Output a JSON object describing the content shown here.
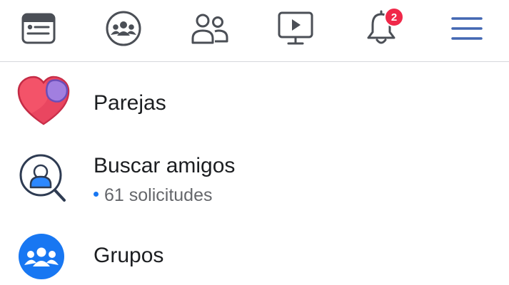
{
  "tabs": [
    {
      "name": "news-feed",
      "icon": "news-feed-icon"
    },
    {
      "name": "groups",
      "icon": "groups-icon"
    },
    {
      "name": "friends",
      "icon": "friends-icon"
    },
    {
      "name": "watch",
      "icon": "video-icon"
    },
    {
      "name": "notifications",
      "icon": "bell-icon",
      "badge": "2"
    },
    {
      "name": "menu",
      "icon": "hamburger-menu-icon"
    }
  ],
  "menu": {
    "items": [
      {
        "label": "Parejas",
        "icon": "dating-heart-icon"
      },
      {
        "label": "Buscar amigos",
        "icon": "find-friends-icon",
        "sublabel": "61 solicitudes"
      },
      {
        "label": "Grupos",
        "icon": "groups-icon"
      }
    ]
  },
  "colors": {
    "accent": "#1877f2",
    "badge": "#f02849",
    "tab_icon": "#4b4f56",
    "menu_icon": "#4267b2"
  }
}
